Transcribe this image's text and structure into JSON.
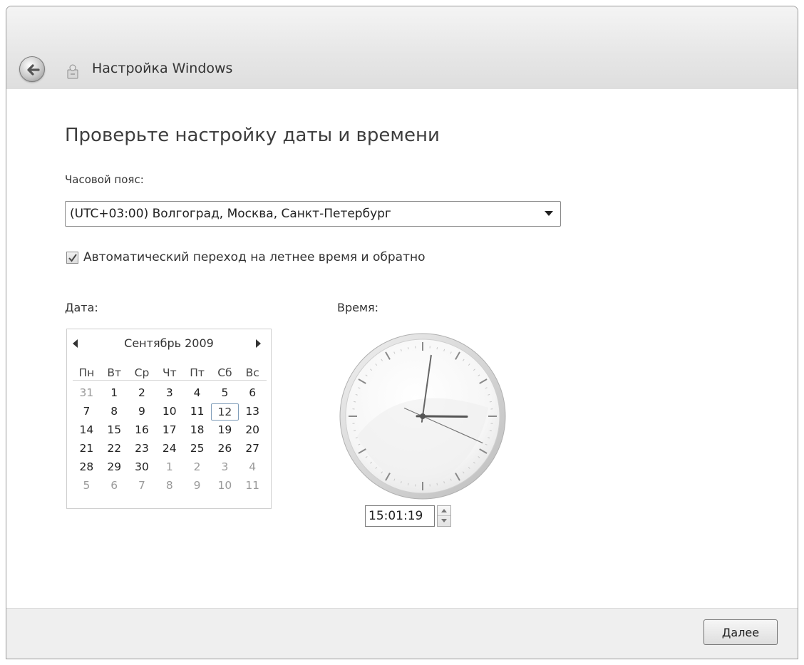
{
  "window": {
    "title": "Настройка Windows",
    "icons": {
      "back": "back-arrow-icon",
      "app": "setup-app-icon"
    }
  },
  "page": {
    "heading": "Проверьте настройку даты и времени"
  },
  "timezone": {
    "label": "Часовой пояс:",
    "selected": "(UTC+03:00) Волгоград, Москва, Санкт-Петербург",
    "arrow_icon": "dropdown-arrow-icon"
  },
  "dst": {
    "label": "Автоматический переход на летнее время и обратно",
    "checked": true
  },
  "date": {
    "label": "Дата:",
    "calendar": {
      "month_year": "Сентябрь 2009",
      "weekdays": [
        "Пн",
        "Вт",
        "Ср",
        "Чт",
        "Пт",
        "Сб",
        "Вс"
      ],
      "weeks": [
        [
          "31",
          "1",
          "2",
          "3",
          "4",
          "5",
          "6"
        ],
        [
          "7",
          "8",
          "9",
          "10",
          "11",
          "12",
          "13"
        ],
        [
          "14",
          "15",
          "16",
          "17",
          "18",
          "19",
          "20"
        ],
        [
          "21",
          "22",
          "23",
          "24",
          "25",
          "26",
          "27"
        ],
        [
          "28",
          "29",
          "30",
          "1",
          "2",
          "3",
          "4"
        ],
        [
          "5",
          "6",
          "7",
          "8",
          "9",
          "10",
          "11"
        ]
      ],
      "selected_day": "12",
      "prev_icon": "chevron-left-icon",
      "next_icon": "chevron-right-icon"
    }
  },
  "time": {
    "label": "Время:",
    "value": "15:01:19",
    "hours": 15,
    "minutes": 1,
    "seconds": 19
  },
  "footer": {
    "next_label": "Далее"
  },
  "colors": {
    "content_bg": "#ffffff",
    "chrome_bg": "#e9e9e9",
    "footer_bg": "#efefef",
    "heading_text": "#3e3e3e"
  }
}
